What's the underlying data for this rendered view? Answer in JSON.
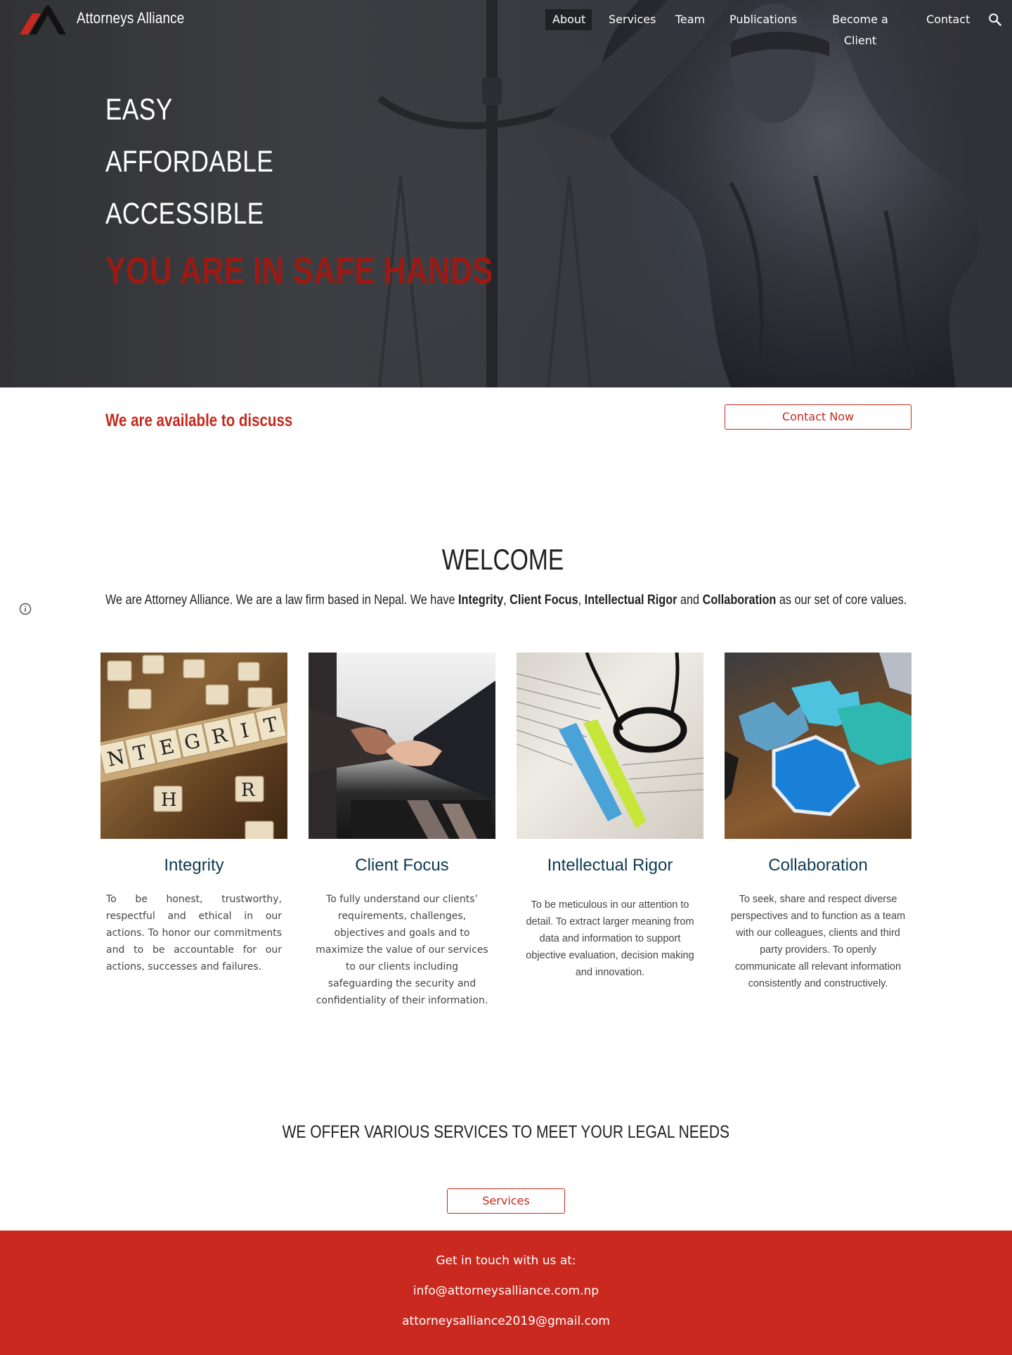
{
  "nav": {
    "site_title": "Attorneys Alliance",
    "items": [
      "About",
      "Services",
      "Team",
      "Publications",
      "Become a Client",
      "Contact"
    ],
    "active": "About"
  },
  "hero": {
    "lines": [
      "EASY",
      "AFFORDABLE",
      "ACCESSIBLE"
    ],
    "tagline": "YOU ARE IN SAFE HANDS"
  },
  "cta": {
    "available": "We are available to discuss",
    "contact_button": "Contact Now"
  },
  "welcome": {
    "title": "WELCOME",
    "intro": "We are Attorney Alliance. We are a law firm based in Nepal. We have ",
    "v1": "Integrity",
    "sep1": ", ",
    "v2": "Client Focus",
    "sep2": ", ",
    "v3": "Intellectual Rigor",
    "sep3": " and ",
    "v4": "Collaboration",
    "outro": " as our set of core values."
  },
  "values": [
    {
      "title": "Integrity",
      "description": "To be honest, trustworthy, respectful and ethical in our actions. To honor our commitments and to be accountable for our actions, successes and failures."
    },
    {
      "title": "Client Focus",
      "description": "To fully understand our clients’ requirements, challenges, objectives and goals and to maximize the value of our services to our clients including safeguarding the security and confidentiality of their information."
    },
    {
      "title": "Intellectual Rigor",
      "description": "To be meticulous in our attention to detail. To extract larger meaning from data and information to support objective evaluation, decision making and innovation."
    },
    {
      "title": "Collaboration",
      "description": "To seek, share and respect diverse perspectives and to function as a team with our colleagues, clients and third party providers. To openly communicate all relevant information consistently and constructively."
    }
  ],
  "services": {
    "heading": "WE OFFER VARIOUS SERVICES TO MEET YOUR LEGAL NEEDS",
    "button": "Services"
  },
  "footer": {
    "lines": [
      "Get in touch with us at:",
      "info@attorneysalliance.com.np",
      "attorneysalliance2019@gmail.com"
    ]
  },
  "colors": {
    "brand_red": "#c9291f",
    "tagline_red": "#9b1b14",
    "value_title_blue": "#0d3a53",
    "nav_active_bg": "#202124"
  },
  "icons": [
    "logo",
    "search-icon",
    "info-icon"
  ]
}
